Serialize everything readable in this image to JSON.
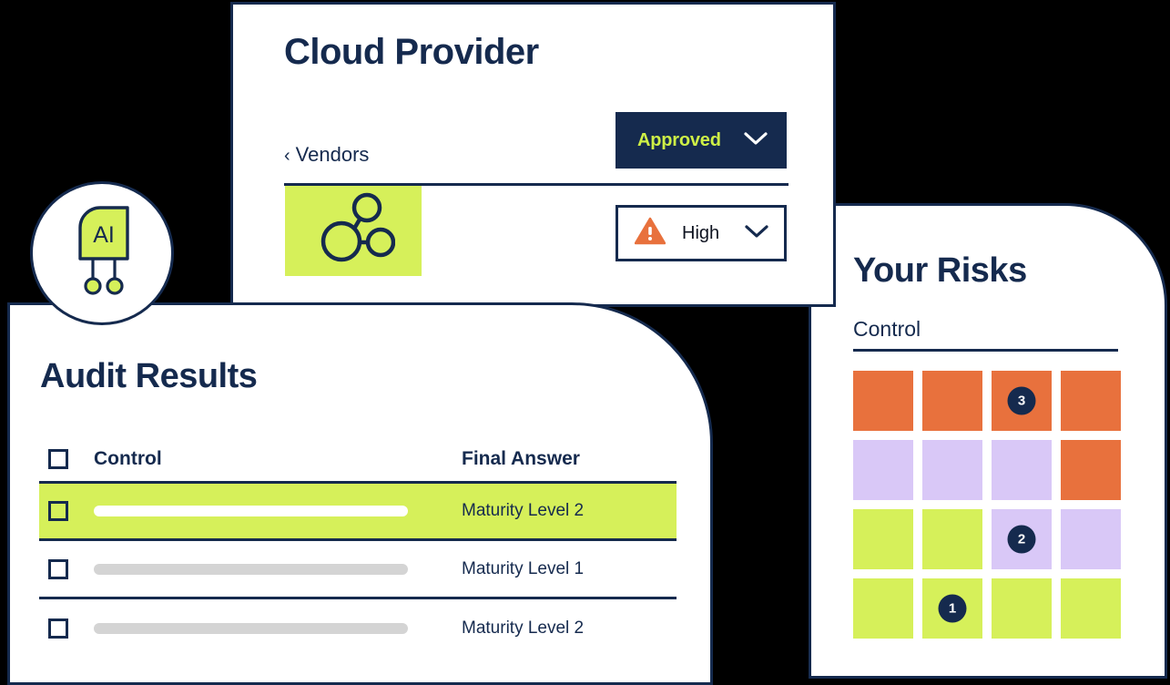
{
  "theme": {
    "navy": "#152A4E",
    "lime": "#D6F05A",
    "orange": "#E8713D",
    "purple": "#D9C8F7",
    "gray_bar": "#D4D4D4",
    "page_bg": "#000000"
  },
  "cloud_provider_card": {
    "title": "Cloud Provider",
    "back_link": "Vendors",
    "back_chevron": "‹",
    "status_button": {
      "label": "Approved",
      "icon": "chevron-down-icon"
    },
    "severity_select": {
      "label": "High",
      "icon": "warning-triangle-icon",
      "chevron": "chevron-down-icon"
    },
    "vendor_icon": "network-nodes-icon"
  },
  "ai_badge": {
    "label": "AI",
    "icon": "ai-chip-icon"
  },
  "audit_card": {
    "title": "Audit Results",
    "columns": {
      "checkbox": "select-all-checkbox",
      "control": "Control",
      "final_answer": "Final Answer"
    },
    "rows": [
      {
        "checked": false,
        "control_redacted": true,
        "final_answer": "Maturity Level 2",
        "highlighted": true
      },
      {
        "checked": false,
        "control_redacted": true,
        "final_answer": "Maturity Level 1",
        "highlighted": false
      },
      {
        "checked": false,
        "control_redacted": true,
        "final_answer": "Maturity Level 2",
        "highlighted": false
      }
    ]
  },
  "risks_card": {
    "title": "Your Risks",
    "subtitle": "Control",
    "grid": {
      "rows": 4,
      "columns": 4,
      "cells": [
        {
          "color": "#E8713D",
          "badge": null
        },
        {
          "color": "#E8713D",
          "badge": null
        },
        {
          "color": "#E8713D",
          "badge": "3"
        },
        {
          "color": "#E8713D",
          "badge": null
        },
        {
          "color": "#D9C8F7",
          "badge": null
        },
        {
          "color": "#D9C8F7",
          "badge": null
        },
        {
          "color": "#D9C8F7",
          "badge": null
        },
        {
          "color": "#E8713D",
          "badge": null
        },
        {
          "color": "#D6F05A",
          "badge": null
        },
        {
          "color": "#D6F05A",
          "badge": null
        },
        {
          "color": "#D9C8F7",
          "badge": "2"
        },
        {
          "color": "#D9C8F7",
          "badge": null
        },
        {
          "color": "#D6F05A",
          "badge": null
        },
        {
          "color": "#D6F05A",
          "badge": "1"
        },
        {
          "color": "#D6F05A",
          "badge": null
        },
        {
          "color": "#D6F05A",
          "badge": null
        }
      ]
    }
  }
}
